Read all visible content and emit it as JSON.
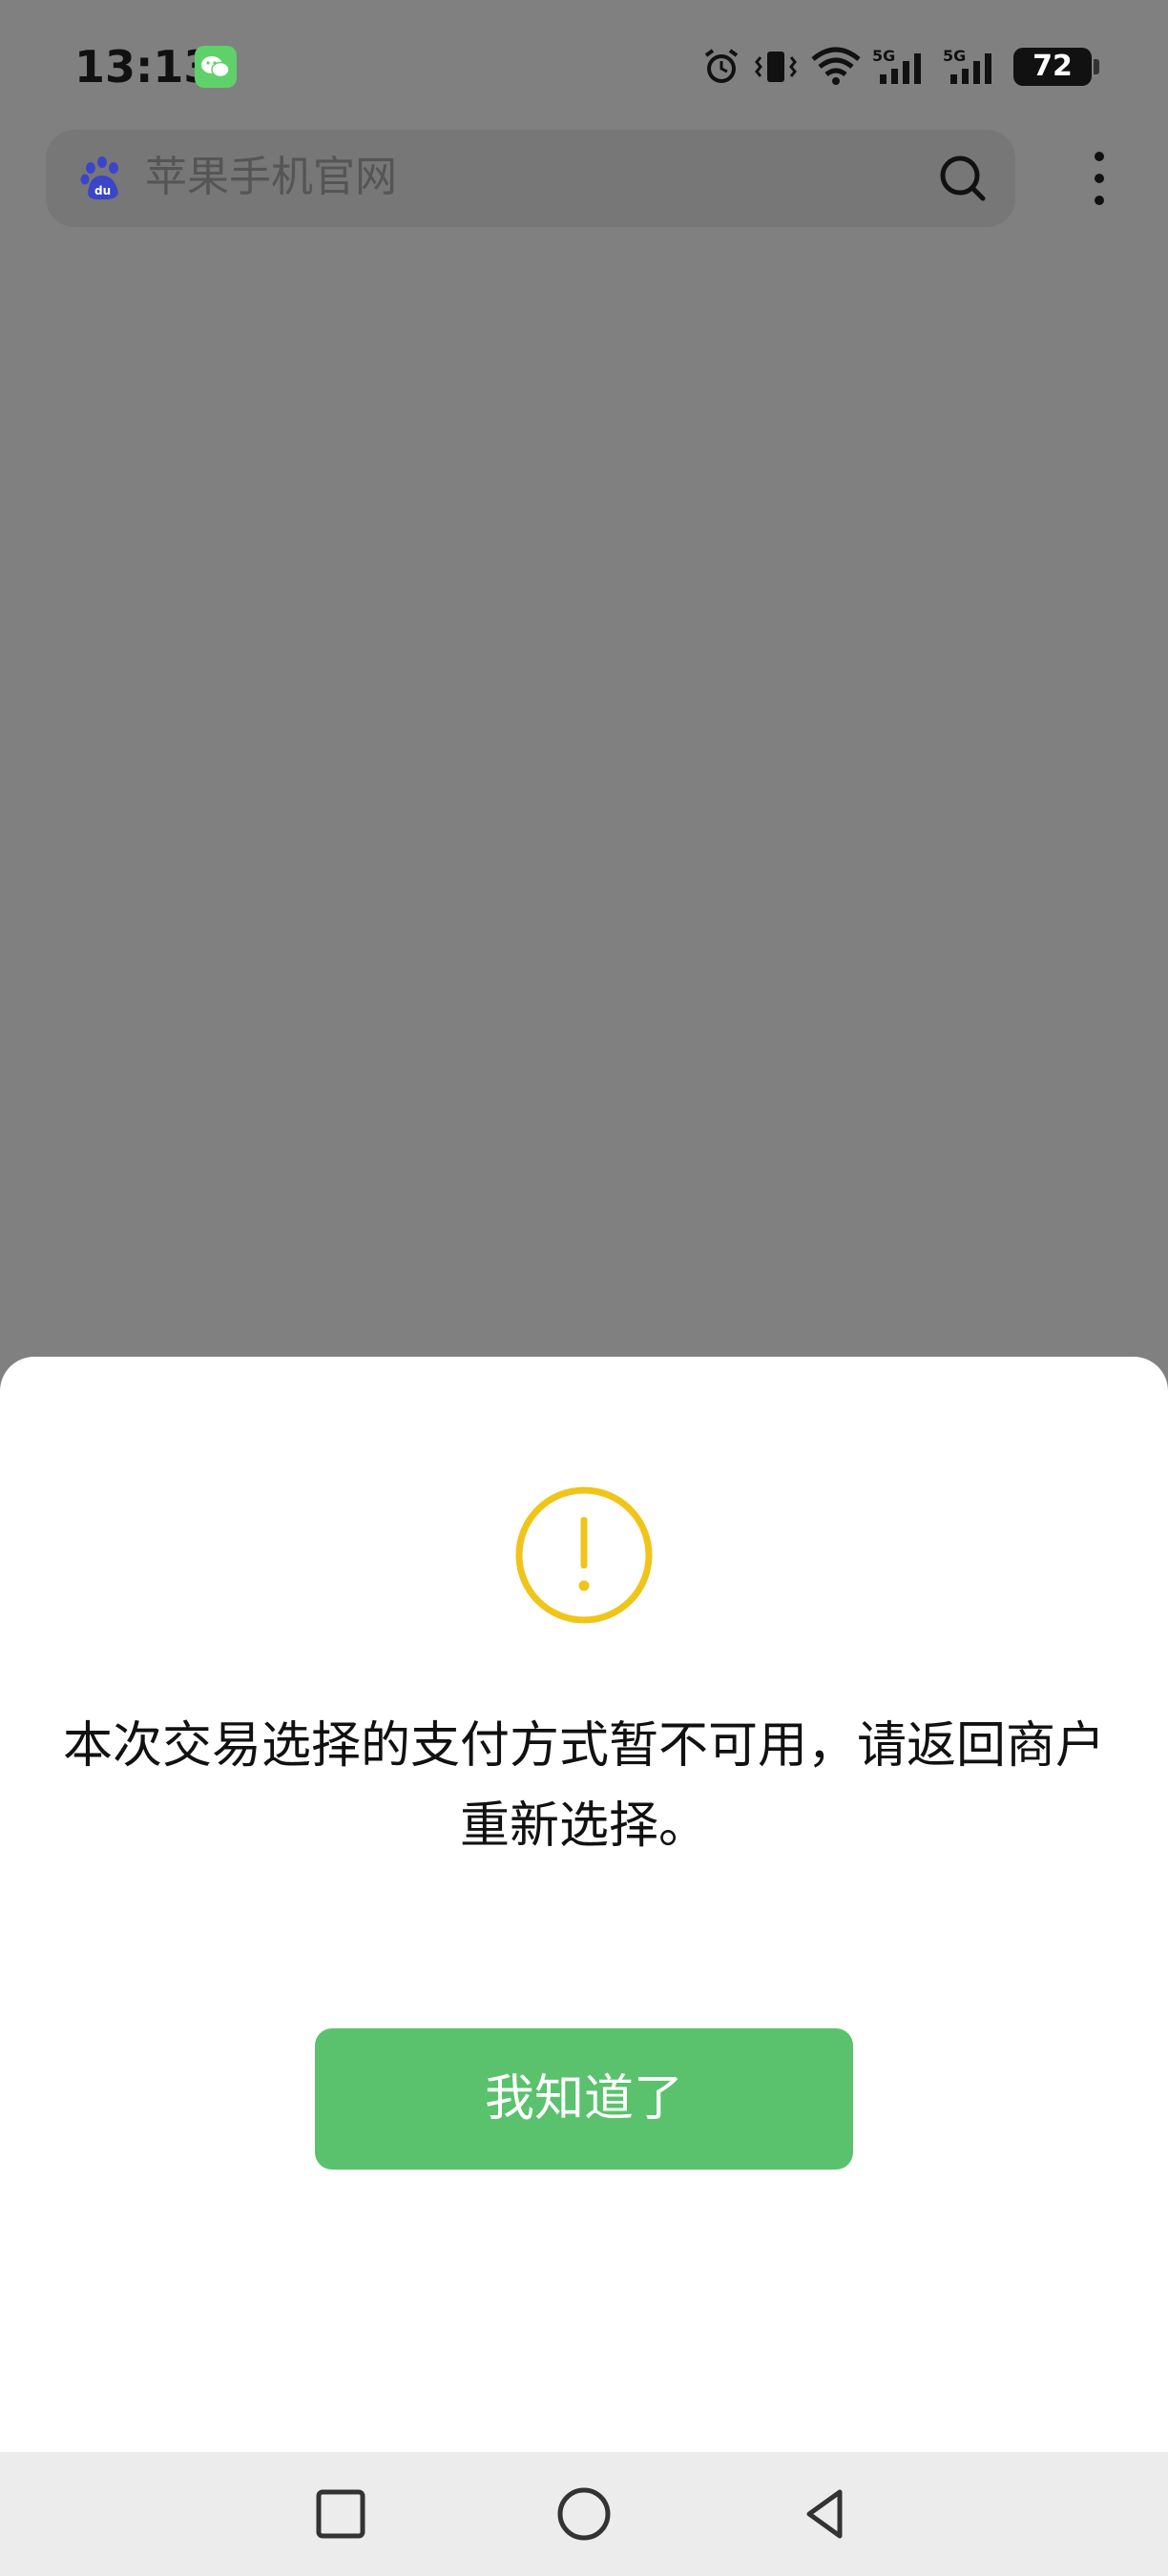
{
  "status_bar": {
    "time": "13:13",
    "notification_icon": "wechat-icon",
    "icons": [
      "alarm-icon",
      "vibrate-icon",
      "wifi-icon",
      "signal-5g-icon",
      "signal-5g-icon"
    ],
    "network_labels": [
      "5G",
      "5G"
    ],
    "battery_level": "72"
  },
  "browser": {
    "search_placeholder": "苹果手机官网",
    "logo": "baidu-paw-icon",
    "search_icon": "search-icon",
    "menu_icon": "more-vertical-icon"
  },
  "dialog": {
    "icon": "warning-icon",
    "icon_color": "#f0c419",
    "message": "本次交易选择的支付方式暂不可用，请返回商户重新选择。",
    "button_label": "我知道了",
    "button_color": "#5ac26c"
  },
  "nav_bar": {
    "buttons": [
      "recents-square-icon",
      "home-circle-icon",
      "back-triangle-icon"
    ]
  }
}
